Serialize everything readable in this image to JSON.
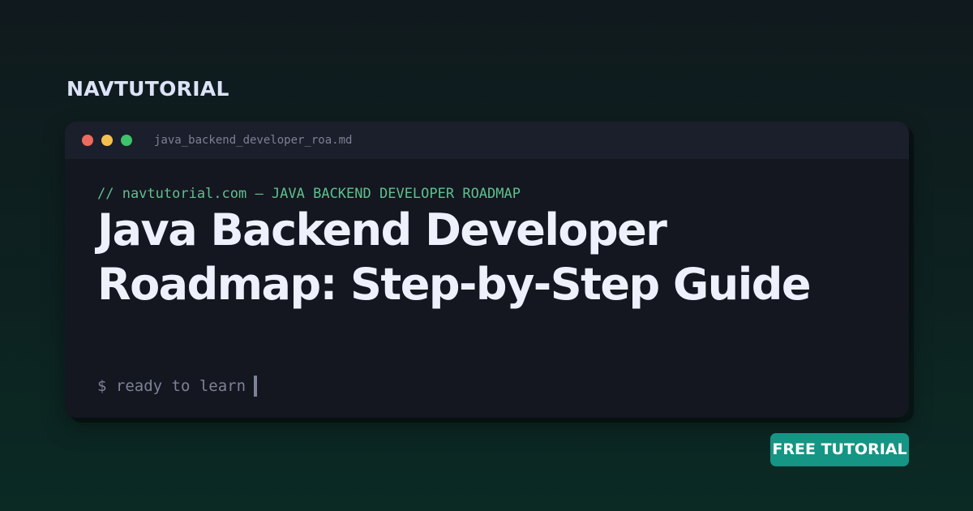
{
  "brand": {
    "name": "NAVTUTORIAL"
  },
  "window": {
    "filename": "java_backend_developer_roa.md",
    "dots": [
      "red-dot",
      "yellow-dot",
      "green-dot"
    ],
    "comment": "// navtutorial.com — JAVA BACKEND DEVELOPER ROADMAP",
    "title": "Java Backend Developer Roadmap: Step-by-Step Guide",
    "prompt": "$ ready to learn"
  },
  "badge": {
    "label": "FREE TUTORIAL"
  },
  "colors": {
    "accent_green": "#5fc08d",
    "badge_teal": "#159584",
    "window_bg": "#141620",
    "titlebar_bg": "#1b1e2b",
    "dot_red": "#ed6a5e",
    "dot_yellow": "#f4bf4f",
    "dot_green": "#3ec26b"
  }
}
